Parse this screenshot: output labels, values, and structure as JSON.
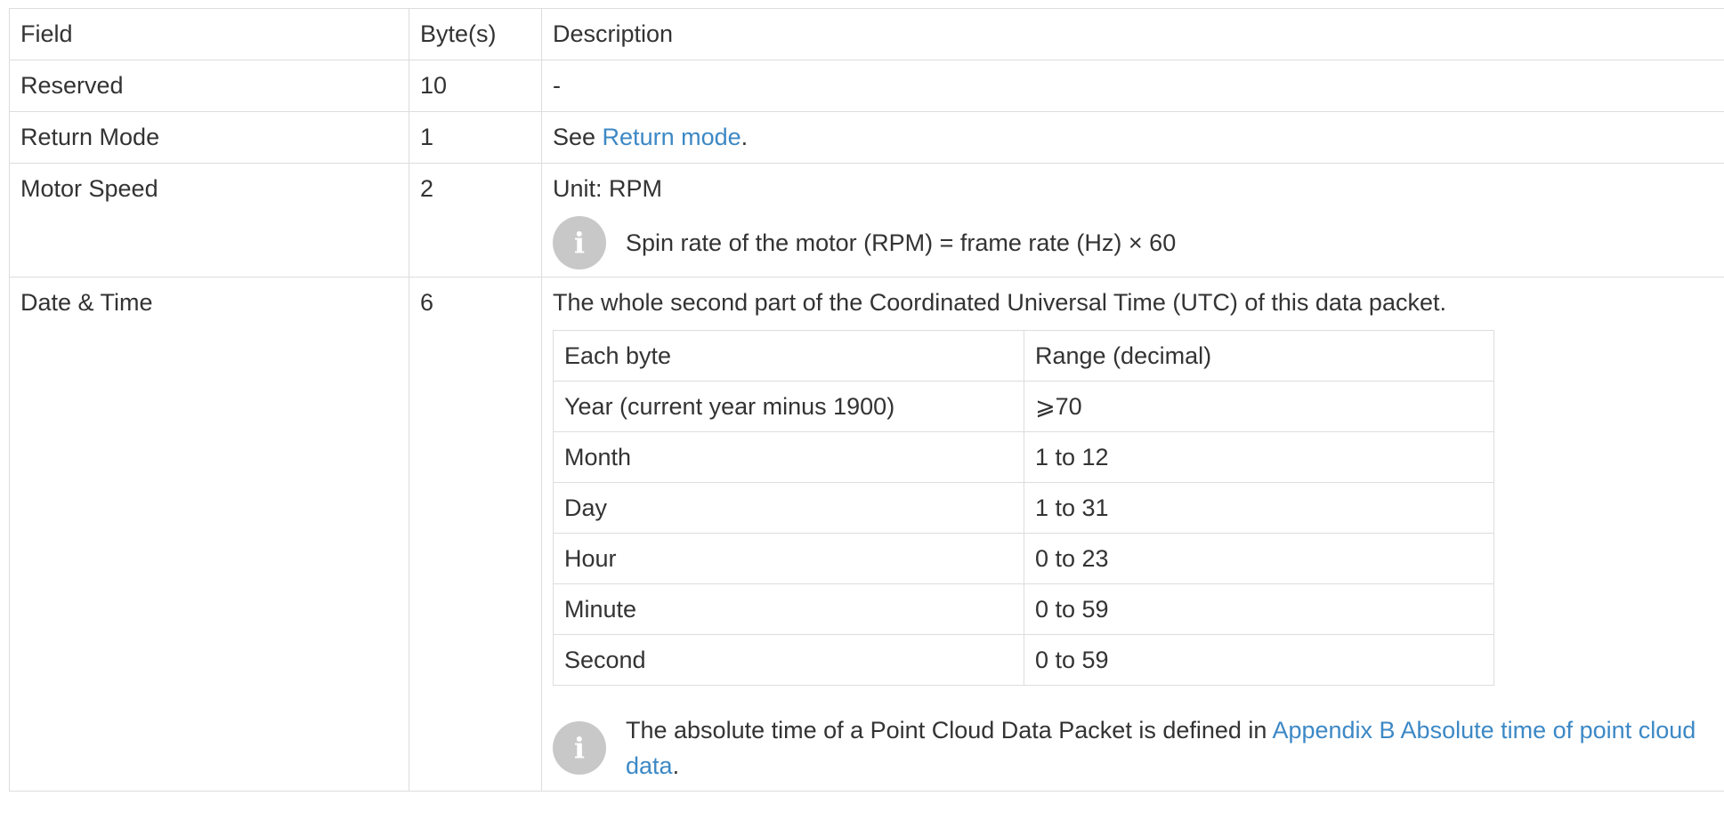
{
  "table": {
    "headers": [
      "Field",
      "Byte(s)",
      "Description"
    ],
    "rows": {
      "reserved": {
        "field": "Reserved",
        "bytes": "10",
        "description": "-"
      },
      "return_mode": {
        "field": "Return Mode",
        "bytes": "1",
        "desc_prefix": "See ",
        "desc_link": "Return mode",
        "desc_suffix": "."
      },
      "motor_speed": {
        "field": "Motor Speed",
        "bytes": "2",
        "unit": "Unit: RPM",
        "note_icon": "info-icon",
        "note": "Spin rate of the motor (RPM) = frame rate (Hz) × 60"
      },
      "date_time": {
        "field": "Date & Time",
        "bytes": "6",
        "intro": "The whole second part of the Coordinated Universal Time (UTC) of this data packet.",
        "sub_headers": [
          "Each byte",
          "Range (decimal)"
        ],
        "sub_rows": [
          [
            "Year (current year minus 1900)",
            "⩾70"
          ],
          [
            "Month",
            "1 to 12"
          ],
          [
            "Day",
            "1 to 31"
          ],
          [
            "Hour",
            "0 to 23"
          ],
          [
            "Minute",
            "0 to 59"
          ],
          [
            "Second",
            "0 to 59"
          ]
        ],
        "note_icon": "info-icon",
        "note_prefix": "The absolute time of a Point Cloud Data Packet is defined in ",
        "note_link": "Appendix B Absolute time of point cloud data",
        "note_suffix": "."
      }
    }
  },
  "colors": {
    "link": "#3c88c5",
    "border": "#dddddd",
    "icon_bg": "#c8c8c8",
    "text": "#333333"
  }
}
